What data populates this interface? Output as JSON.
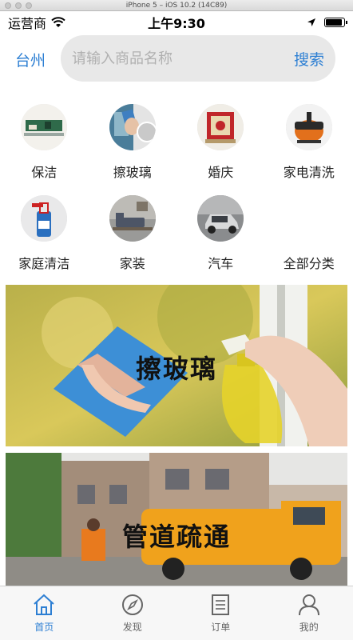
{
  "window": {
    "title": "iPhone 5 – iOS 10.2 (14C89)"
  },
  "status_bar": {
    "carrier": "运营商",
    "time": "上午9:30"
  },
  "search": {
    "city": "台州",
    "placeholder": "请输入商品名称",
    "button": "搜索"
  },
  "categories": [
    {
      "label": "保洁",
      "icon": "cleaning"
    },
    {
      "label": "擦玻璃",
      "icon": "window-cleaning"
    },
    {
      "label": "婚庆",
      "icon": "wedding"
    },
    {
      "label": "家电清洗",
      "icon": "appliance-cleaning"
    },
    {
      "label": "家庭清洁",
      "icon": "home-cleaning"
    },
    {
      "label": "家装",
      "icon": "decoration"
    },
    {
      "label": "汽车",
      "icon": "car"
    },
    {
      "label": "全部分类",
      "icon": "all-categories"
    }
  ],
  "banners": [
    {
      "title": "擦玻璃"
    },
    {
      "title": "管道疏通"
    }
  ],
  "tabbar": [
    {
      "label": "首页",
      "icon": "home-icon",
      "active": true
    },
    {
      "label": "发现",
      "icon": "compass-icon",
      "active": false
    },
    {
      "label": "订单",
      "icon": "order-icon",
      "active": false
    },
    {
      "label": "我的",
      "icon": "user-icon",
      "active": false
    }
  ],
  "colors": {
    "accent": "#2d7fd3",
    "search_bg": "#e8e8e8"
  }
}
